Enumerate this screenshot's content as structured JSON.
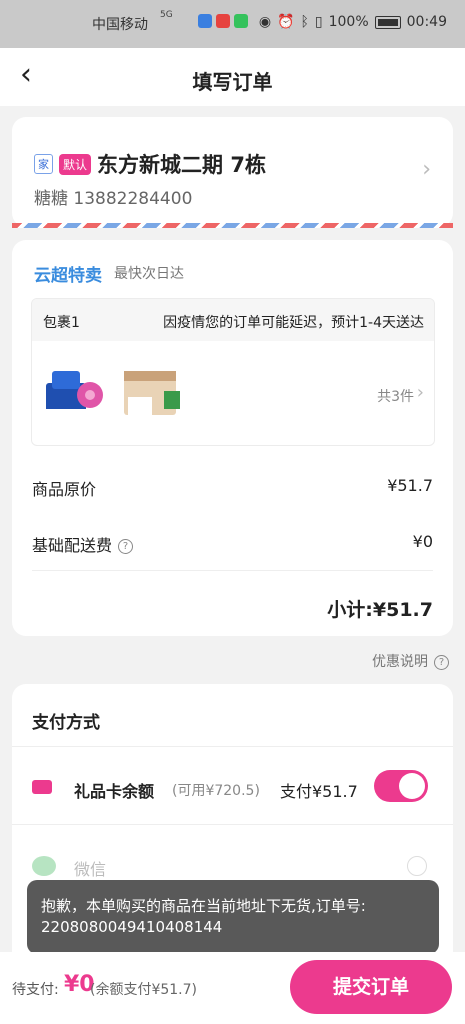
{
  "status_bar": {
    "carrier": "中国移动",
    "network": "5G",
    "battery": "100%",
    "time": "00:49"
  },
  "nav": {
    "title": "填写订单",
    "back_icon": "chevron-left-icon"
  },
  "address": {
    "tag_home": "家",
    "tag_default": "默认",
    "text": "东方新城二期 7栋",
    "contact": "糖糖 13882284400"
  },
  "order": {
    "shop_name": "云超特卖",
    "eta": "最快次日达",
    "package": {
      "name": "包裹1",
      "notice": "因疫情您的订单可能延迟，预计1-4天送达",
      "count": "共3件"
    },
    "original_price_label": "商品原价",
    "original_price": "¥51.7",
    "delivery_label": "基础配送费",
    "delivery_fee": "¥0",
    "subtotal": "小计:¥51.7"
  },
  "promo_info": "优惠说明",
  "payment": {
    "title": "支付方式",
    "gift_card_label": "礼品卡余额",
    "gift_card_available": "(可用¥720.5)",
    "gift_card_pay": "支付¥51.7",
    "gift_card_enabled": true,
    "wechat_label": "微信"
  },
  "toast": {
    "message": "抱歉，本单购买的商品在当前地址下无货,订单号:",
    "order_no": "2208080049410408144"
  },
  "bottom": {
    "due_label": "待支付:",
    "due_amount": "¥0",
    "due_note": "(余额支付¥51.7)",
    "submit_label": "提交订单"
  },
  "colors": {
    "accent": "#ec3a8e",
    "shop_blue": "#3a8cde"
  }
}
